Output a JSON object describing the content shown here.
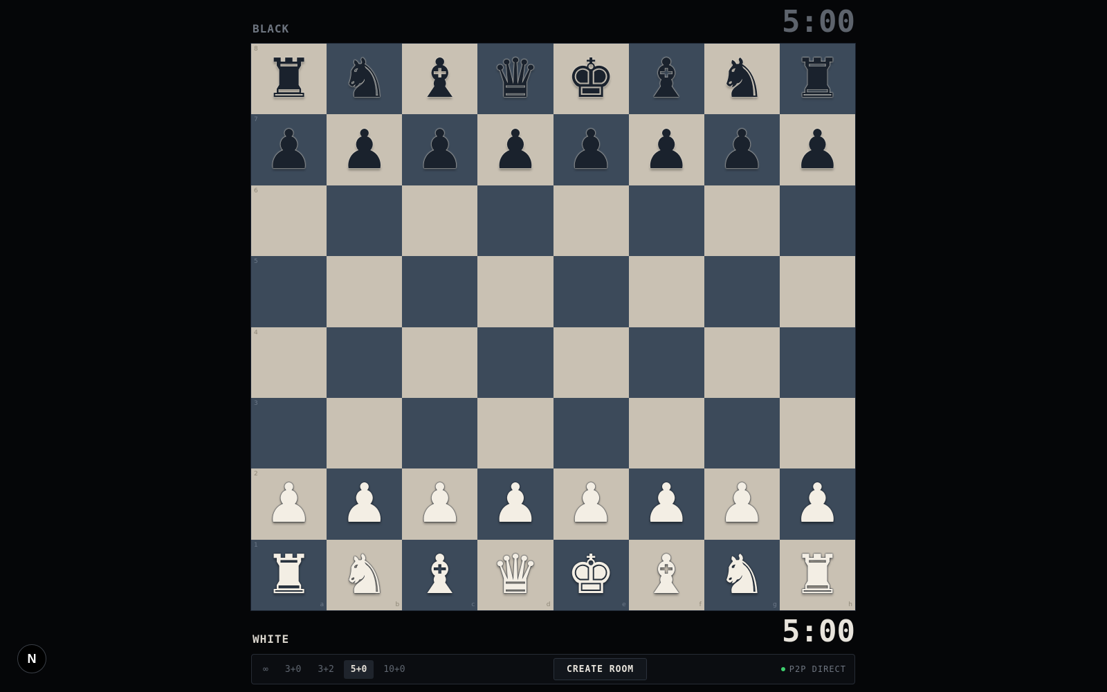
{
  "players": {
    "black": {
      "label": "BLACK",
      "clock": "5:00"
    },
    "white": {
      "label": "WHITE",
      "clock": "5:00"
    }
  },
  "board": {
    "files": [
      "a",
      "b",
      "c",
      "d",
      "e",
      "f",
      "g",
      "h"
    ],
    "ranks": [
      "8",
      "7",
      "6",
      "5",
      "4",
      "3",
      "2",
      "1"
    ],
    "position": [
      [
        "br",
        "bn",
        "bb",
        "bq",
        "bk",
        "bb",
        "bn",
        "br"
      ],
      [
        "bp",
        "bp",
        "bp",
        "bp",
        "bp",
        "bp",
        "bp",
        "bp"
      ],
      [
        "",
        "",
        "",
        "",
        "",
        "",
        "",
        ""
      ],
      [
        "",
        "",
        "",
        "",
        "",
        "",
        "",
        ""
      ],
      [
        "",
        "",
        "",
        "",
        "",
        "",
        "",
        ""
      ],
      [
        "",
        "",
        "",
        "",
        "",
        "",
        "",
        ""
      ],
      [
        "wp",
        "wp",
        "wp",
        "wp",
        "wp",
        "wp",
        "wp",
        "wp"
      ],
      [
        "wr",
        "wn",
        "wb",
        "wq",
        "wk",
        "wb",
        "wn",
        "wr"
      ]
    ],
    "colors": {
      "light": "#c9c1b3",
      "dark": "#3c4a5a"
    }
  },
  "time_controls": {
    "options": [
      "∞",
      "3+0",
      "3+2",
      "5+0",
      "10+0"
    ],
    "selected": "5+0"
  },
  "create_room_label": "CREATE ROOM",
  "status": {
    "label": "P2P DIRECT",
    "color": "#3ecf6e"
  },
  "logo": {
    "letter": "N"
  }
}
